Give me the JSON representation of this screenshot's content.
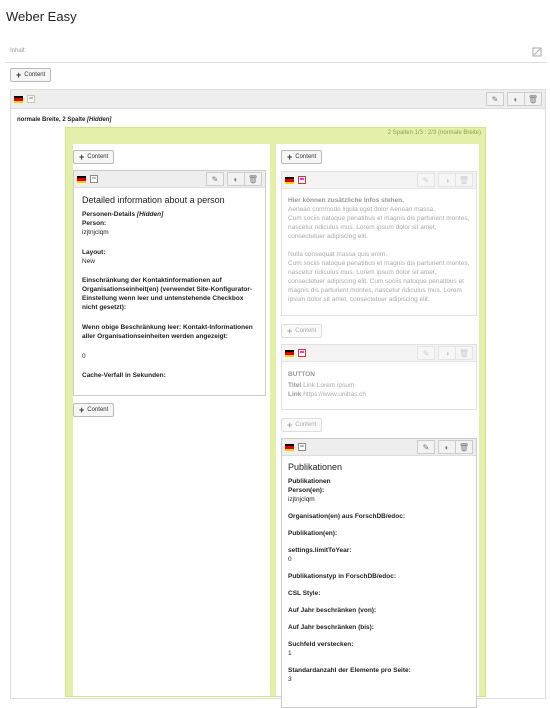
{
  "page_title": "Weber Easy",
  "inhalt_label": "Inhalt",
  "content_btn": "Content",
  "main_element": {
    "title_prefix": "normale Breite, 2 Spalte",
    "title_hidden": "[Hidden]"
  },
  "grid": {
    "label": "2 Spalten 1/3 : 2/3 (normale Breite)"
  },
  "left_card": {
    "title": "Detailed information about a person",
    "f1_label": "Personen-Details",
    "f1_hidden": "[Hidden]",
    "f2_label": "Person:",
    "f2_value": "izjtnjclqm",
    "f3_label": "Layout:",
    "f3_value": "New",
    "f4_label": "Einschränkung der Kontaktinformationen auf Organisationseinheit(en) (verwendet Site-Konfigurator-Einstellung wenn leer und untenstehende Checkbox nicht gesetzt):",
    "f5_label": "Wenn obige Beschränkung leer: Kontakt-Informationen aller Organisationseinheiten werden angezeigt:",
    "f5_value": "0",
    "f6_label": "Cache-Verfall in Sekunden:"
  },
  "hidden_text_card": {
    "heading": "Hier können zusätzliche Infos stehen.",
    "p1": "Aenean commodo ligula eget dolor Aenean massa.",
    "p2": "Cum sociis natoque penatibus et magnis dis parturient montes, nascetur ridiculus mus. Lorem ipsum dolor sit amet, consectetuer adipiscing elit.",
    "p3": "Nulla consequat massa quis enim.",
    "p4": "Cum sociis natoque penatibus et magnis dis parturient montes, nascetur ridiculus mus. Lorem ipsum dolor sit amet, consectetuer adipiscing elit. Cum sociis natoque penatibus et magnis dis parturient montes, nascetur ridiculus mus. Lorem ipsum dolor sit amet, consectetuer adipiscing elit."
  },
  "button_card": {
    "heading": "BUTTON",
    "titel_label": "Titel",
    "titel_value": "Link Lorem ipsum",
    "link_label": "Link",
    "link_value": "https://www.unibas.ch"
  },
  "pub_card": {
    "title": "Publikationen",
    "f1": "Publikationen",
    "f2": "Person(en):",
    "f2_value": "izjtnjclqm",
    "f3": "Organisation(en) aus ForschDB/edoc:",
    "f4": "Publikation(en):",
    "f5": "settings.limitToYear:",
    "f5_value": "0",
    "f6": "Publikationstyp in ForschDB/edoc:",
    "f7": "CSL Style:",
    "f8": "Auf Jahr beschränken (von):",
    "f9": "Auf Jahr beschränken (bis):",
    "f10": "Suchfeld verstecken:",
    "f10_value": "1",
    "f11": "Standardanzahl der Elemente pro Seite:",
    "f11_value": "3"
  },
  "icons": {
    "edit": "pencil-icon",
    "toggle": "toggle-icon",
    "delete": "trash-icon",
    "flag": "german-flag-icon"
  }
}
